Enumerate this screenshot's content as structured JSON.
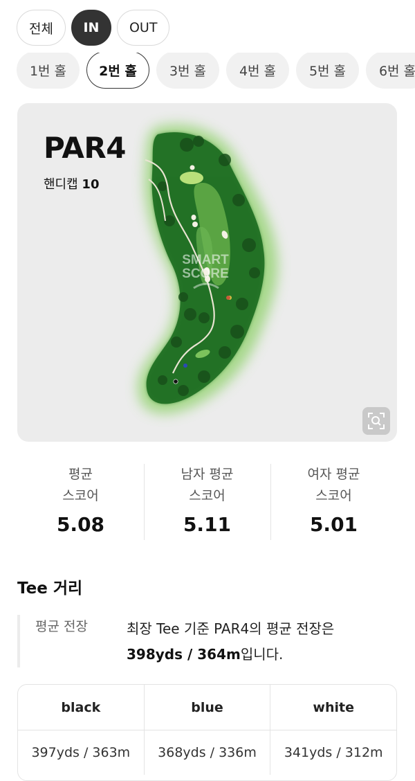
{
  "filters": [
    "전체",
    "IN",
    "OUT"
  ],
  "holes": [
    "1번 홀",
    "2번 홀",
    "3번 홀",
    "4번 홀",
    "5번 홀",
    "6번 홀"
  ],
  "course": {
    "par": "PAR4",
    "handicap_label": "핸디캡",
    "handicap_value": "10",
    "watermark_line1": "SMART",
    "watermark_line2": "SCORE"
  },
  "stats": [
    {
      "label": "평균\n스코어",
      "value": "5.08"
    },
    {
      "label": "남자 평균\n스코어",
      "value": "5.11"
    },
    {
      "label": "여자 평균\n스코어",
      "value": "5.01"
    }
  ],
  "tee": {
    "title": "Tee 거리",
    "avg_label": "평균 전장",
    "desc_prefix": "최장 Tee 기준 PAR4의 평균 전장은",
    "desc_bold": "398yds / 364m",
    "desc_suffix": "입니다.",
    "columns": [
      "black",
      "blue",
      "white"
    ],
    "values": [
      "397yds / 363m",
      "368yds / 336m",
      "341yds / 312m"
    ]
  },
  "colors": {
    "active_chip": "#333333",
    "fairway": "#4f9a3b",
    "rough": "#1f6b22",
    "green": "#b9e07a"
  }
}
